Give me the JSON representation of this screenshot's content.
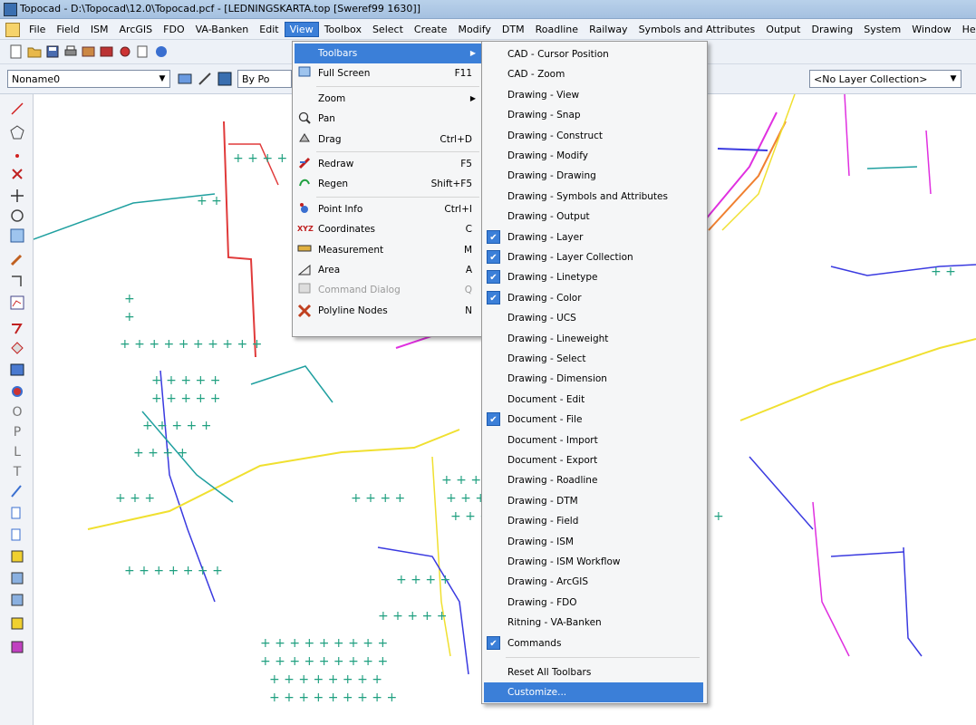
{
  "window": {
    "title": "Topocad - D:\\Topocad\\12.0\\Topocad.pcf - [LEDNINGSKARTA.top [Sweref99 1630]]"
  },
  "menubar": {
    "items": [
      "File",
      "Field",
      "ISM",
      "ArcGIS",
      "FDO",
      "VA-Banken",
      "Edit",
      "View",
      "Toolbox",
      "Select",
      "Create",
      "Modify",
      "DTM",
      "Roadline",
      "Railway",
      "Symbols and Attributes",
      "Output",
      "Drawing",
      "System",
      "Window",
      "Hel"
    ],
    "active": "View"
  },
  "toolbar2": {
    "layer_combo": "Noname0",
    "linetype_combo": "By Po",
    "layer_collection_combo": "<No Layer Collection>"
  },
  "left_toolbar_icons": [
    "line-icon",
    "pentagon-icon",
    "point-icon",
    "cross-icon",
    "move-icon",
    "circle-icon",
    "grid-icon",
    "pencil-icon",
    "trim-icon",
    "chart-icon",
    "polyline-icon",
    "region-icon",
    "table-icon",
    "rotate-icon",
    "o-icon",
    "p-icon",
    "l-icon",
    "t-icon",
    "dimension-icon",
    "insert-icon",
    "insert2-icon",
    "attr-icon",
    "attr2-icon",
    "attr3-icon",
    "attr4-icon"
  ],
  "left_toolbar_letters": {
    "o": "O",
    "p": "P",
    "l": "L",
    "t": "T"
  },
  "view_menu": {
    "items": [
      {
        "label": "Toolbars",
        "shortcut": "",
        "icon": "",
        "submenu": true,
        "highlight": true
      },
      {
        "label": "Full Screen",
        "shortcut": "F11",
        "icon": "fullscreen-icon"
      },
      {
        "sep": true
      },
      {
        "label": "Zoom",
        "shortcut": "",
        "submenu": true
      },
      {
        "label": "Pan",
        "shortcut": "",
        "icon": "pan-icon"
      },
      {
        "label": "Drag",
        "shortcut": "Ctrl+D",
        "icon": "drag-icon"
      },
      {
        "sep": true
      },
      {
        "label": "Redraw",
        "shortcut": "F5",
        "icon": "redraw-icon"
      },
      {
        "label": "Regen",
        "shortcut": "Shift+F5",
        "icon": "regen-icon"
      },
      {
        "sep": true
      },
      {
        "label": "Point Info",
        "shortcut": "Ctrl+I",
        "icon": "point-info-icon"
      },
      {
        "label": "Coordinates",
        "shortcut": "C",
        "icon": "xyz-icon",
        "icon_text": "XYZ"
      },
      {
        "label": "Measurement",
        "shortcut": "M",
        "icon": "ruler-icon"
      },
      {
        "label": "Area",
        "shortcut": "A",
        "icon": "area-icon"
      },
      {
        "label": "Command Dialog",
        "shortcut": "Q",
        "icon": "command-icon",
        "disabled": true
      },
      {
        "label": "Polyline Nodes",
        "shortcut": "N",
        "icon": "nodes-icon"
      }
    ]
  },
  "toolbars_submenu": {
    "items": [
      {
        "label": "CAD - Cursor Position",
        "checked": false
      },
      {
        "label": "CAD - Zoom",
        "checked": false
      },
      {
        "label": "Drawing - View",
        "checked": false
      },
      {
        "label": "Drawing - Snap",
        "checked": false
      },
      {
        "label": "Drawing - Construct",
        "checked": false
      },
      {
        "label": "Drawing - Modify",
        "checked": false
      },
      {
        "label": "Drawing - Drawing",
        "checked": false
      },
      {
        "label": "Drawing - Symbols and Attributes",
        "checked": false
      },
      {
        "label": "Drawing - Output",
        "checked": false
      },
      {
        "label": "Drawing - Layer",
        "checked": true
      },
      {
        "label": "Drawing - Layer Collection",
        "checked": true
      },
      {
        "label": "Drawing - Linetype",
        "checked": true
      },
      {
        "label": "Drawing - Color",
        "checked": true
      },
      {
        "label": "Drawing - UCS",
        "checked": false
      },
      {
        "label": "Drawing - Lineweight",
        "checked": false
      },
      {
        "label": "Drawing - Select",
        "checked": false
      },
      {
        "label": "Drawing - Dimension",
        "checked": false
      },
      {
        "label": "Document - Edit",
        "checked": false
      },
      {
        "label": "Document - File",
        "checked": true
      },
      {
        "label": "Document - Import",
        "checked": false
      },
      {
        "label": "Document - Export",
        "checked": false
      },
      {
        "label": "Drawing - Roadline",
        "checked": false
      },
      {
        "label": "Drawing - DTM",
        "checked": false
      },
      {
        "label": "Drawing - Field",
        "checked": false
      },
      {
        "label": "Drawing - ISM",
        "checked": false
      },
      {
        "label": "Drawing - ISM Workflow",
        "checked": false
      },
      {
        "label": "Drawing - ArcGIS",
        "checked": false
      },
      {
        "label": "Drawing - FDO",
        "checked": false
      },
      {
        "label": "Ritning - VA-Banken",
        "checked": false
      },
      {
        "label": "Commands",
        "checked": true
      }
    ],
    "reset_label": "Reset All Toolbars",
    "customize_label": "Customize..."
  },
  "colors": {
    "menu_highlight": "#3b7fd8",
    "line_red": "#e03a3a",
    "line_yellow": "#f0e030",
    "line_blue": "#3a3ae0",
    "line_magenta": "#e030e0",
    "line_teal": "#20a0a0",
    "symbol_green": "#20a080"
  }
}
